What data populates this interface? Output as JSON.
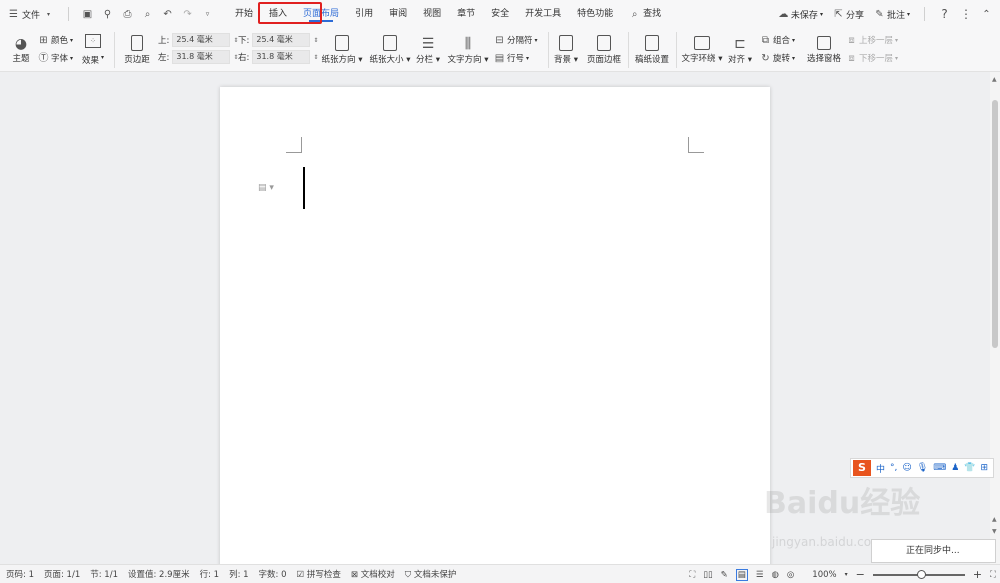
{
  "menubar": {
    "file_label": "文件",
    "tabs": [
      {
        "label": "开始"
      },
      {
        "label": "插入"
      },
      {
        "label": "页面布局"
      },
      {
        "label": "引用"
      },
      {
        "label": "审阅"
      },
      {
        "label": "视图"
      },
      {
        "label": "章节"
      },
      {
        "label": "安全"
      },
      {
        "label": "开发工具"
      },
      {
        "label": "特色功能"
      }
    ],
    "active_tab": "页面布局",
    "search_label": "查找",
    "unsaved_label": "未保存",
    "share_label": "分享",
    "comment_label": "批注"
  },
  "ribbon": {
    "theme": "主题",
    "color": "颜色",
    "font": "字体",
    "effect": "效果",
    "margins": "页边距",
    "margin_top_label": "上:",
    "margin_top_value": "25.4 毫米",
    "margin_bottom_label": "下:",
    "margin_bottom_value": "25.4 毫米",
    "margin_left_label": "左:",
    "margin_left_value": "31.8 毫米",
    "margin_right_label": "右:",
    "margin_right_value": "31.8 毫米",
    "orientation": "纸张方向",
    "paper_size": "纸张大小",
    "columns": "分栏",
    "text_direction": "文字方向",
    "separator": "分隔符",
    "line_number": "行号",
    "background": "背景",
    "page_border": "页面边框",
    "manuscript": "稿纸设置",
    "text_wrap": "文字环绕",
    "align": "对齐",
    "group": "组合",
    "rotate": "旋转",
    "selection_pane": "选择窗格",
    "bring_forward": "上移一层",
    "send_backward": "下移一层"
  },
  "ime": {
    "mode": "中",
    "logo": "S"
  },
  "watermark": {
    "brand": "Baidu经验",
    "site": "jingyan.baidu.com"
  },
  "toast": "正在同步中...",
  "status": {
    "page_num": "页码: 1",
    "pages": "页面: 1/1",
    "section": "节: 1/1",
    "position": "设置值: 2.9厘米",
    "row": "行: 1",
    "col": "列: 1",
    "word_count": "字数: 0",
    "spell_check": "拼写检查",
    "doc_check": "文档校对",
    "protect": "文档未保护",
    "zoom": "100%"
  }
}
